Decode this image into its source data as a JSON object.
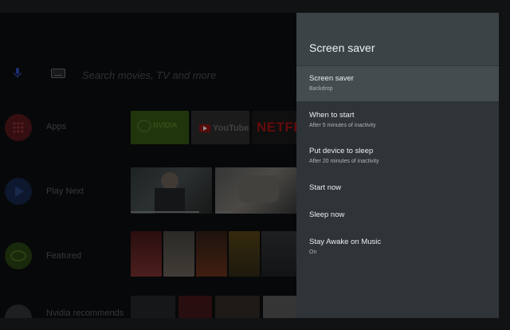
{
  "home": {
    "search_placeholder": "Search movies, TV and more",
    "rows": [
      {
        "label": "Apps"
      },
      {
        "label": "Play Next"
      },
      {
        "label": "Featured"
      },
      {
        "label": "Nvidia recommends"
      }
    ],
    "apps": [
      {
        "name": "NVIDIA"
      },
      {
        "name": "YouTube"
      },
      {
        "name": "NETFLIX"
      }
    ]
  },
  "panel": {
    "title": "Screen saver",
    "items": [
      {
        "title": "Screen saver",
        "subtitle": "Backdrop"
      },
      {
        "title": "When to start",
        "subtitle": "After 5 minutes of inactivity"
      },
      {
        "title": "Put device to sleep",
        "subtitle": "After 20 minutes of inactivity"
      },
      {
        "title": "Start now",
        "subtitle": ""
      },
      {
        "title": "Sleep now",
        "subtitle": ""
      },
      {
        "title": "Stay Awake on Music",
        "subtitle": "On"
      }
    ]
  },
  "colors": {
    "panel_bg": "#2f3438",
    "panel_header_bg": "#3c4346",
    "selected_bg": "#454c50"
  }
}
